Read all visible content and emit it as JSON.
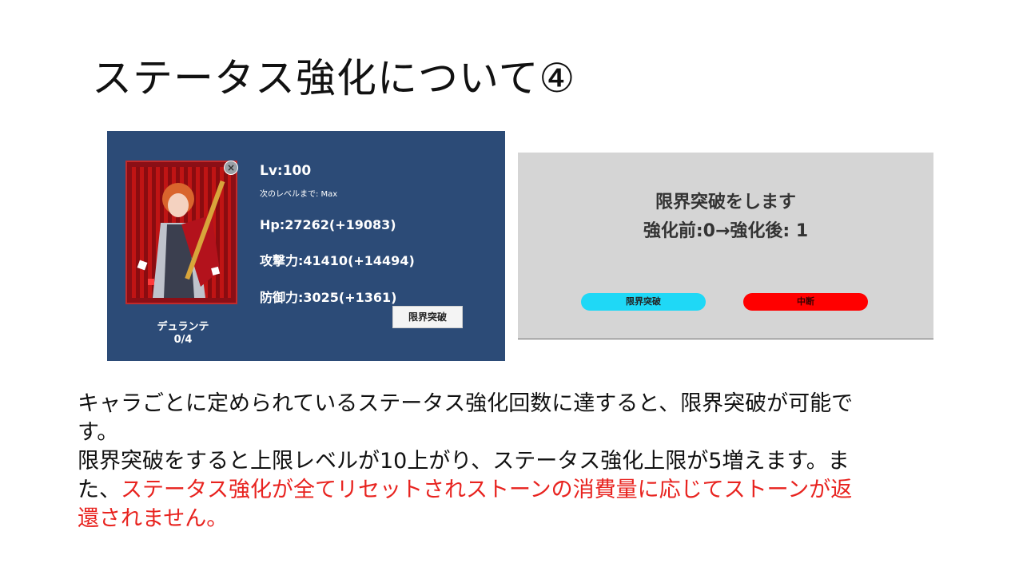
{
  "slide": {
    "title": "ステータス強化について④"
  },
  "character_panel": {
    "level": "Lv:100",
    "next_level": "次のレベルまで: Max",
    "hp": "Hp:27262(+19083)",
    "attack": "攻撃力:41410(+14494)",
    "defense": "防御力:3025(+1361)",
    "name": "デュランテ",
    "count": "0/4",
    "limit_break_button": "限界突破",
    "close_icon": "close-icon"
  },
  "dialog": {
    "line1": "限界突破をします",
    "line2": "強化前:0→強化後: 1",
    "confirm_button": "限界突破",
    "cancel_button": "中断",
    "confirm_color": "#1fd8f6",
    "cancel_color": "#ff0000"
  },
  "body": {
    "para1": "キャラごとに定められているステータス強化回数に達すると、限界突破が可能です。",
    "para2_normal": "限界突破をすると上限レベルが10上がり、ステータス強化上限が5増えます。また、",
    "para2_red": "ステータス強化が全てリセットされストーンの消費量に応じてストーンが返還されません。",
    "red_color": "#e8231f"
  }
}
